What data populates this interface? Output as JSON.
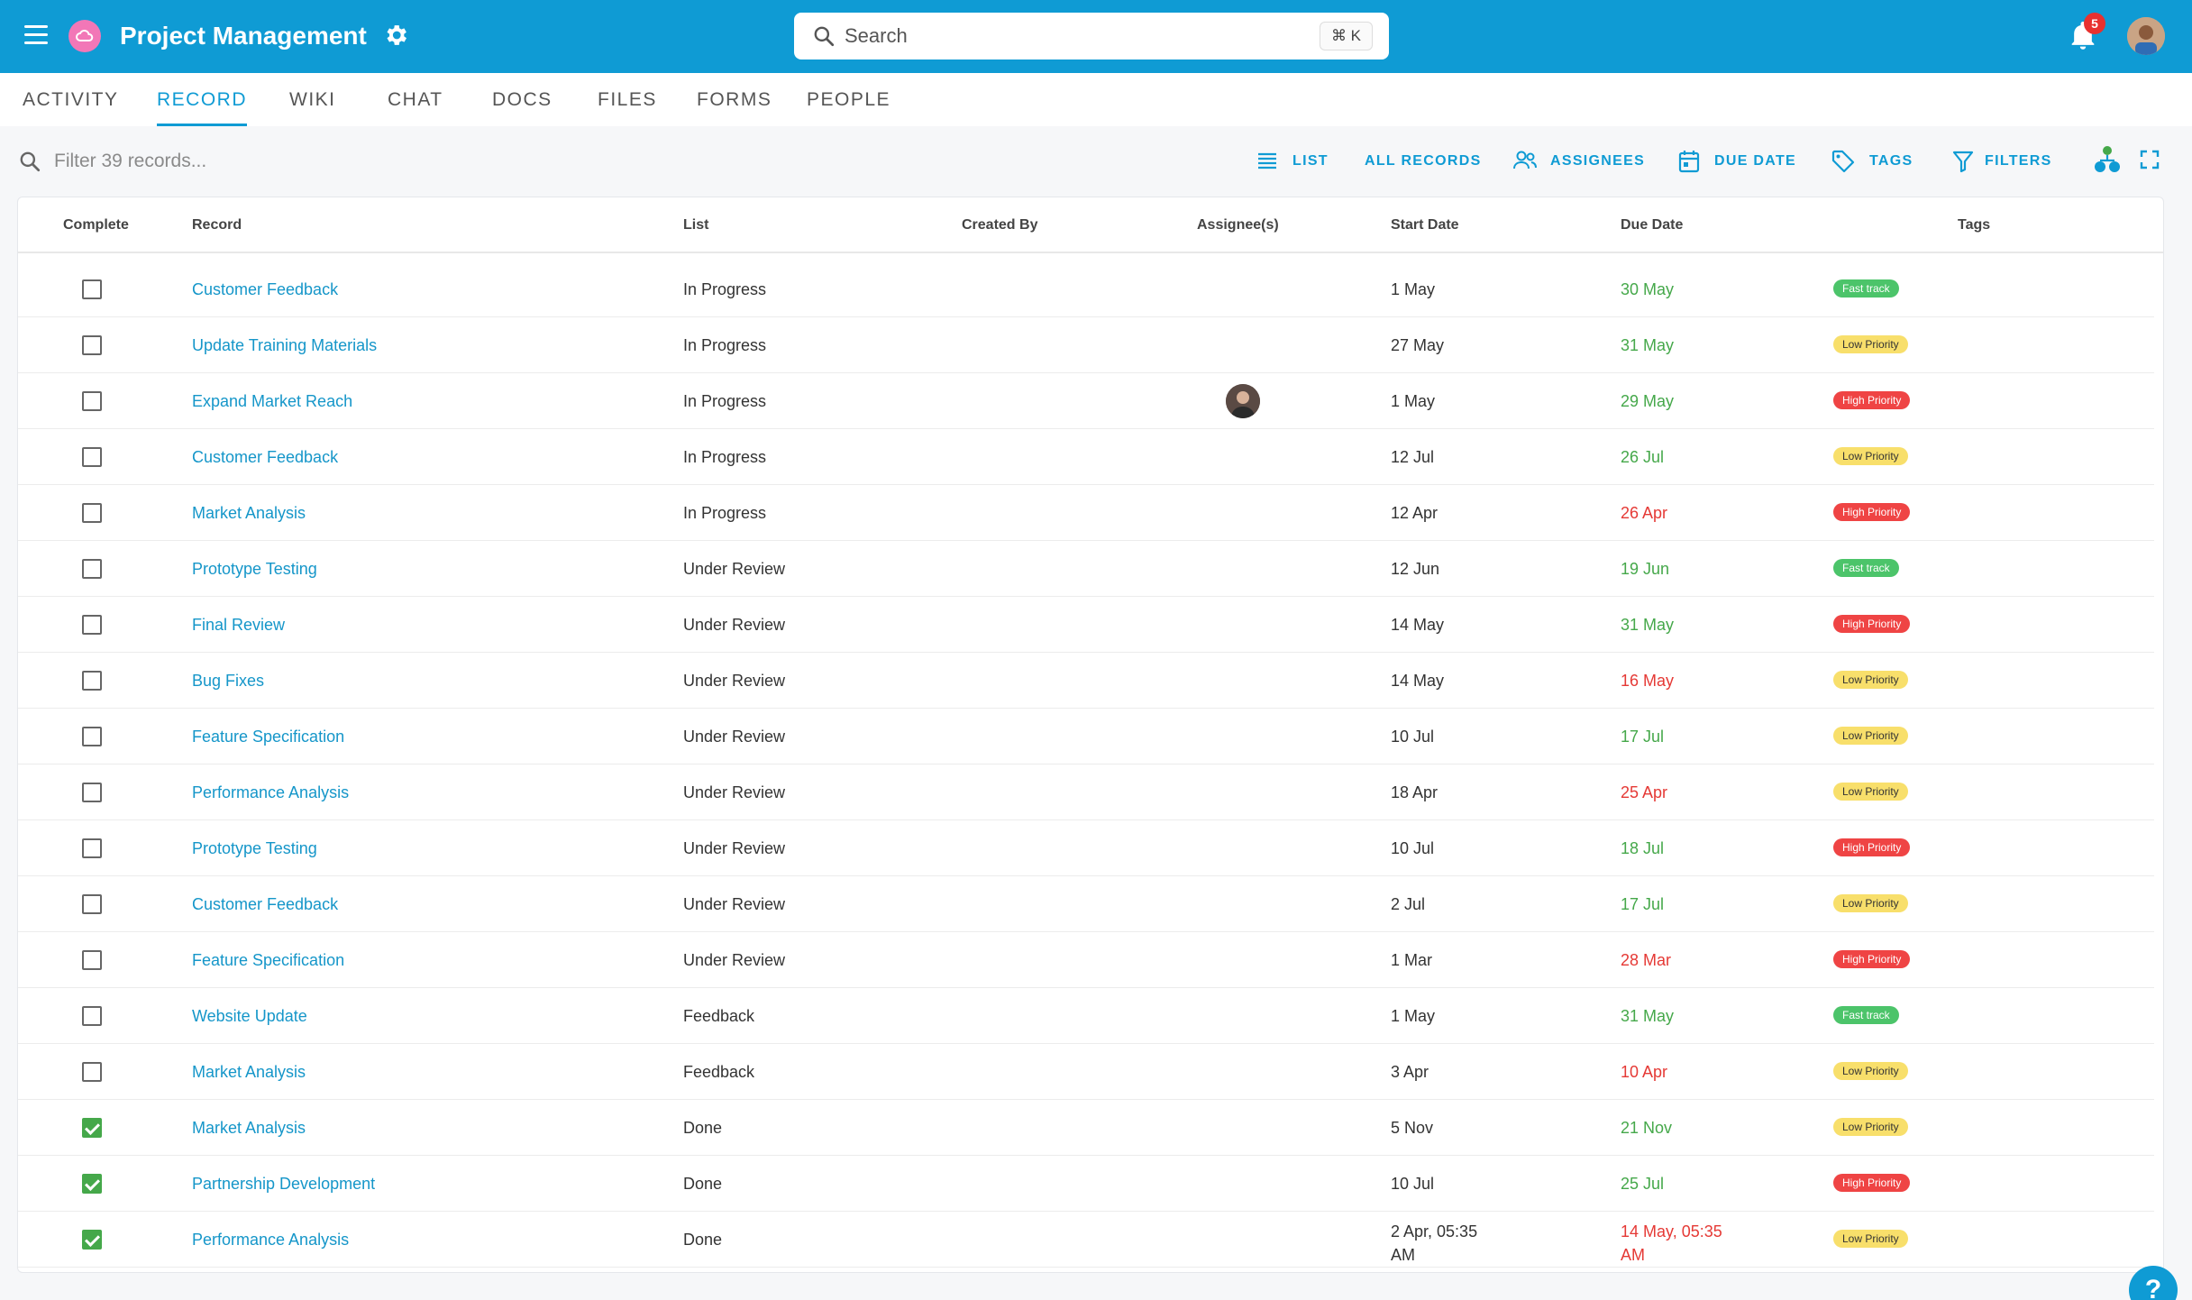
{
  "header": {
    "title": "Project Management",
    "search_placeholder": "Search",
    "search_shortcut": "⌘ K",
    "notification_count": "5",
    "colors": {
      "bar": "#0f9bd4",
      "logo": "#f277b7",
      "badge": "#e8312f"
    }
  },
  "tabs": [
    {
      "label": "ACTIVITY",
      "active": false
    },
    {
      "label": "RECORD",
      "active": true
    },
    {
      "label": "WIKI",
      "active": false
    },
    {
      "label": "CHAT",
      "active": false
    },
    {
      "label": "DOCS",
      "active": false
    },
    {
      "label": "FILES",
      "active": false
    },
    {
      "label": "FORMS",
      "active": false
    },
    {
      "label": "PEOPLE",
      "active": false
    }
  ],
  "toolbar": {
    "filter_placeholder": "Filter 39 records...",
    "list_label": "LIST",
    "all_records_label": "ALL RECORDS",
    "assignees_label": "ASSIGNEES",
    "due_date_label": "DUE DATE",
    "tags_label": "TAGS",
    "filters_label": "FILTERS"
  },
  "table": {
    "columns": [
      "Complete",
      "Record",
      "List",
      "Created By",
      "Assignee(s)",
      "Start Date",
      "Due Date",
      "Tags"
    ],
    "rows": [
      {
        "complete": false,
        "record": "Customer Feedback",
        "list": "In Progress",
        "assignee": false,
        "start": "1 May",
        "due": "30 May",
        "due_status": "ok",
        "tag": "Fast track"
      },
      {
        "complete": false,
        "record": "Update Training Materials",
        "list": "In Progress",
        "assignee": false,
        "start": "27 May",
        "due": "31 May",
        "due_status": "ok",
        "tag": "Low Priority"
      },
      {
        "complete": false,
        "record": "Expand Market Reach",
        "list": "In Progress",
        "assignee": true,
        "start": "1 May",
        "due": "29 May",
        "due_status": "ok",
        "tag": "High Priority"
      },
      {
        "complete": false,
        "record": "Customer Feedback",
        "list": "In Progress",
        "assignee": false,
        "start": "12 Jul",
        "due": "26 Jul",
        "due_status": "ok",
        "tag": "Low Priority"
      },
      {
        "complete": false,
        "record": "Market Analysis",
        "list": "In Progress",
        "assignee": false,
        "start": "12 Apr",
        "due": "26 Apr",
        "due_status": "overdue",
        "tag": "High Priority"
      },
      {
        "complete": false,
        "record": "Prototype Testing",
        "list": "Under Review",
        "assignee": false,
        "start": "12 Jun",
        "due": "19 Jun",
        "due_status": "ok",
        "tag": "Fast track"
      },
      {
        "complete": false,
        "record": "Final Review",
        "list": "Under Review",
        "assignee": false,
        "start": "14 May",
        "due": "31 May",
        "due_status": "ok",
        "tag": "High Priority"
      },
      {
        "complete": false,
        "record": "Bug Fixes",
        "list": "Under Review",
        "assignee": false,
        "start": "14 May",
        "due": "16 May",
        "due_status": "overdue",
        "tag": "Low Priority"
      },
      {
        "complete": false,
        "record": "Feature Specification",
        "list": "Under Review",
        "assignee": false,
        "start": "10 Jul",
        "due": "17 Jul",
        "due_status": "ok",
        "tag": "Low Priority"
      },
      {
        "complete": false,
        "record": "Performance Analysis",
        "list": "Under Review",
        "assignee": false,
        "start": "18 Apr",
        "due": "25 Apr",
        "due_status": "overdue",
        "tag": "Low Priority"
      },
      {
        "complete": false,
        "record": "Prototype Testing",
        "list": "Under Review",
        "assignee": false,
        "start": "10 Jul",
        "due": "18 Jul",
        "due_status": "ok",
        "tag": "High Priority"
      },
      {
        "complete": false,
        "record": "Customer Feedback",
        "list": "Under Review",
        "assignee": false,
        "start": "2 Jul",
        "due": "17 Jul",
        "due_status": "ok",
        "tag": "Low Priority"
      },
      {
        "complete": false,
        "record": "Feature Specification",
        "list": "Under Review",
        "assignee": false,
        "start": "1 Mar",
        "due": "28 Mar",
        "due_status": "overdue",
        "tag": "High Priority"
      },
      {
        "complete": false,
        "record": "Website Update",
        "list": "Feedback",
        "assignee": false,
        "start": "1 May",
        "due": "31 May",
        "due_status": "ok",
        "tag": "Fast track"
      },
      {
        "complete": false,
        "record": "Market Analysis",
        "list": "Feedback",
        "assignee": false,
        "start": "3 Apr",
        "due": "10 Apr",
        "due_status": "overdue",
        "tag": "Low Priority"
      },
      {
        "complete": true,
        "record": "Market Analysis",
        "list": "Done",
        "assignee": false,
        "start": "5 Nov",
        "due": "21 Nov",
        "due_status": "ok",
        "tag": "Low Priority"
      },
      {
        "complete": true,
        "record": "Partnership Development",
        "list": "Done",
        "assignee": false,
        "start": "10 Jul",
        "due": "25 Jul",
        "due_status": "ok",
        "tag": "High Priority"
      },
      {
        "complete": true,
        "record": "Performance Analysis",
        "list": "Done",
        "assignee": false,
        "start": "2 Apr, 05:35 AM",
        "due": "14 May, 05:35 AM",
        "due_status": "overdue",
        "tag": "Low Priority"
      }
    ]
  },
  "tag_colors": {
    "Fast track": "#4cc46a",
    "Low Priority": "#f8df6b",
    "High Priority": "#ef4444"
  },
  "due_colors": {
    "ok": "#45a84a",
    "overdue": "#e53935"
  },
  "help_label": "?"
}
